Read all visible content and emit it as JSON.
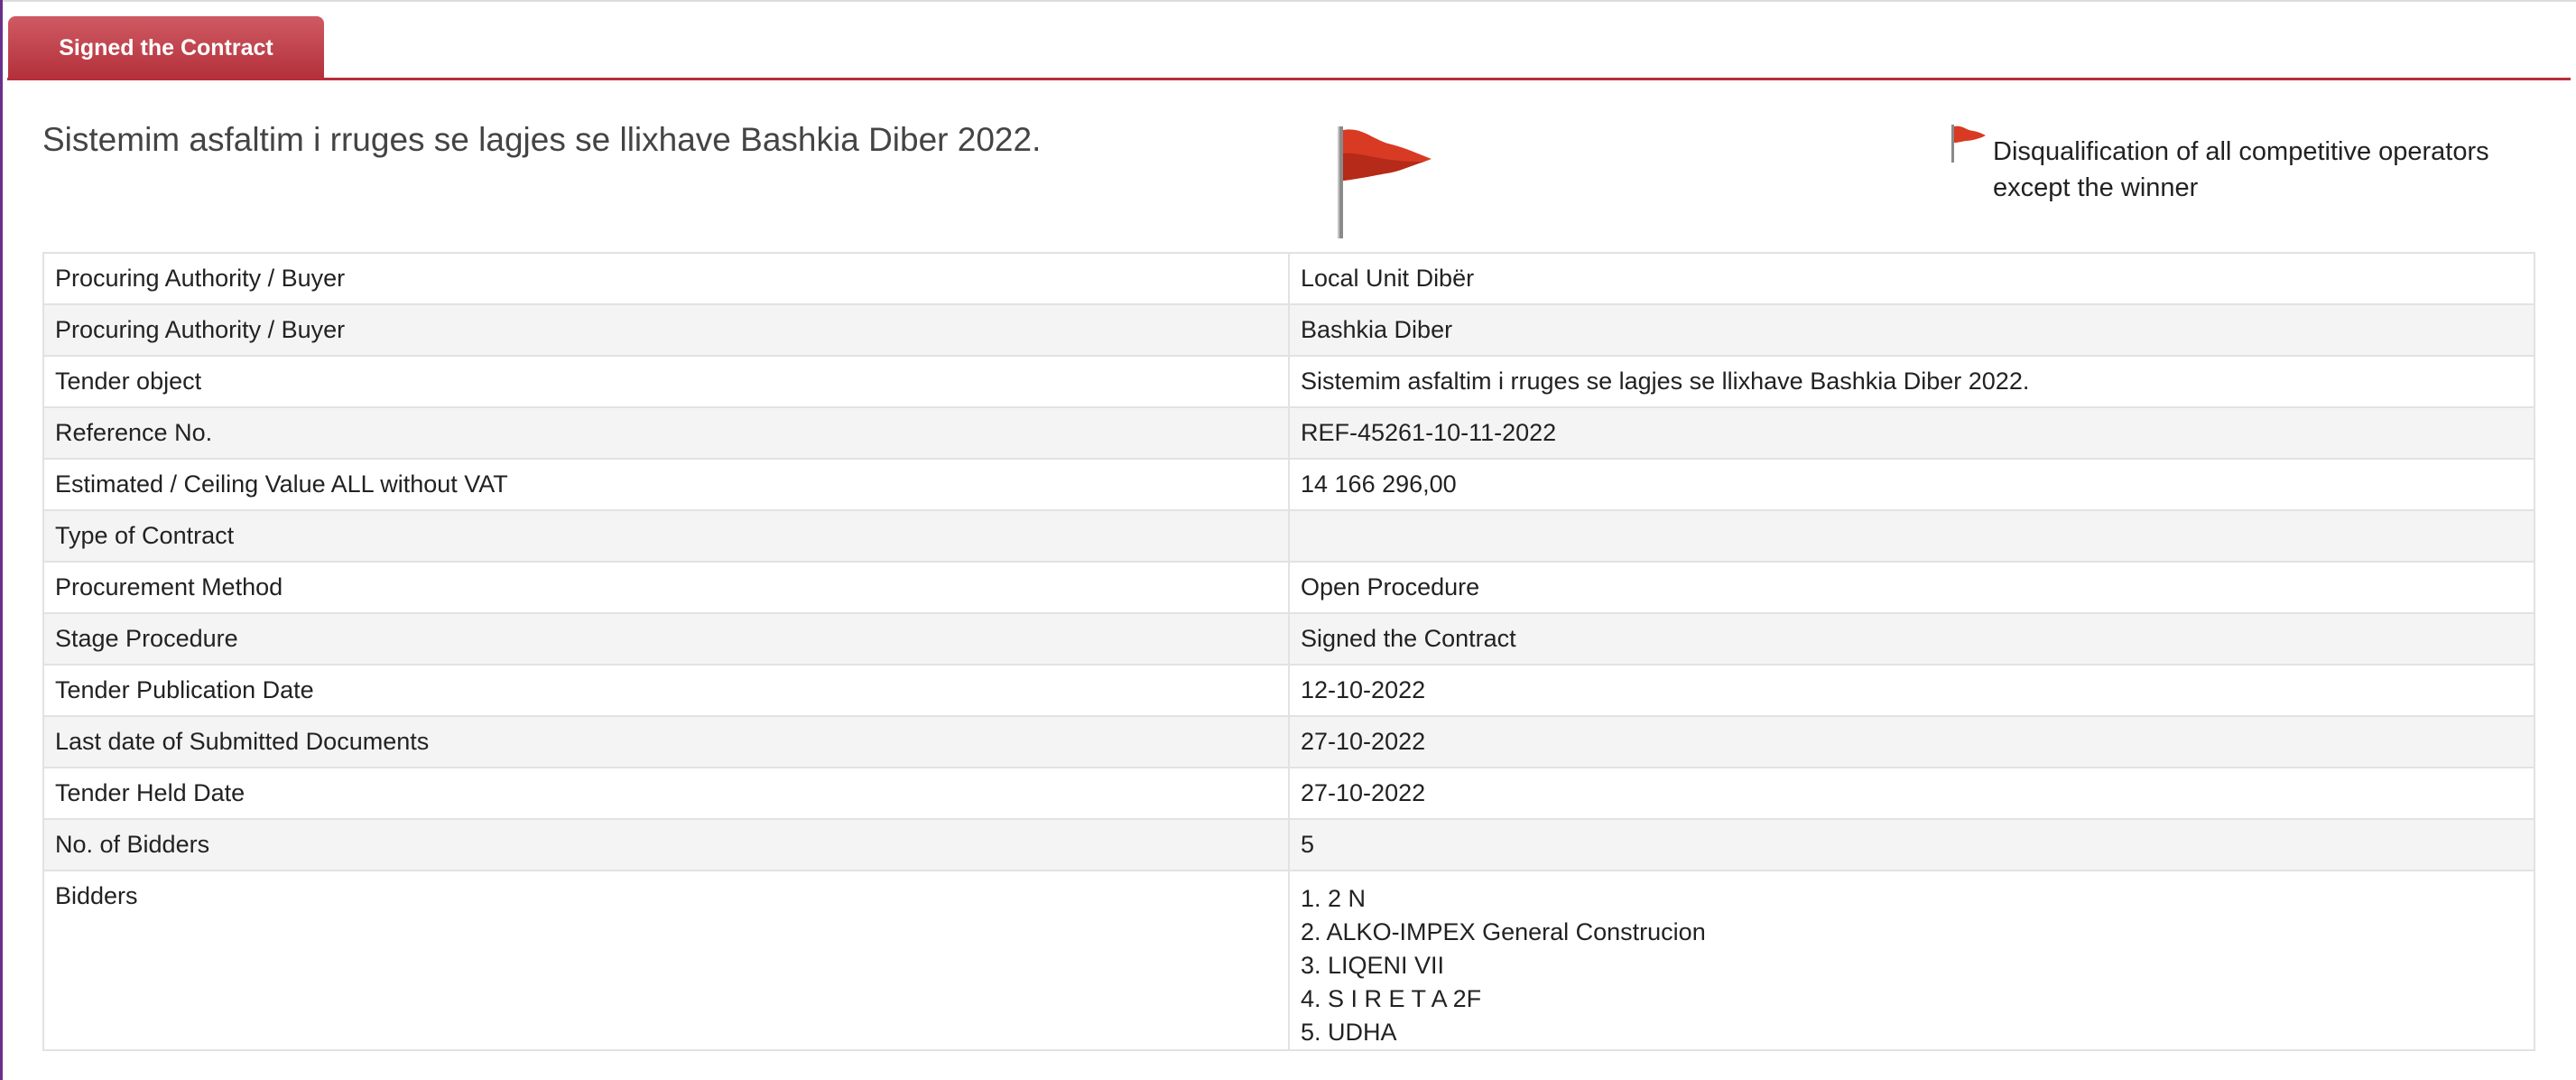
{
  "tab": {
    "label": "Signed the Contract"
  },
  "page_title": "Sistemim asfaltim i rruges se lagjes se llixhave Bashkia Diber 2022.",
  "flag_note": "Disqualification of all competitive operators except the winner",
  "colors": {
    "accent": "#b82e3a",
    "flag": "#d93a23",
    "row_alt": "#f4f4f4",
    "border": "#e2e2e2"
  },
  "icons": {
    "big_flag": "red-flag-icon",
    "small_flag": "red-flag-icon"
  },
  "details": [
    {
      "label": "Procuring Authority / Buyer",
      "value": "Local Unit Dibër"
    },
    {
      "label": "Procuring Authority / Buyer",
      "value": "Bashkia Diber"
    },
    {
      "label": "Tender object",
      "value": "Sistemim asfaltim i rruges se lagjes se llixhave Bashkia Diber 2022."
    },
    {
      "label": "Reference No.",
      "value": "REF-45261-10-11-2022"
    },
    {
      "label": "Estimated / Ceiling Value ALL without VAT",
      "value": "14 166 296,00"
    },
    {
      "label": "Type of Contract",
      "value": ""
    },
    {
      "label": "Procurement Method",
      "value": "Open Procedure"
    },
    {
      "label": "Stage Procedure",
      "value": "Signed the Contract"
    },
    {
      "label": "Tender Publication Date",
      "value": "12-10-2022"
    },
    {
      "label": "Last date of Submitted Documents",
      "value": "27-10-2022"
    },
    {
      "label": "Tender Held Date",
      "value": "27-10-2022"
    },
    {
      "label": "No. of Bidders",
      "value": "5"
    }
  ],
  "bidders": {
    "label": "Bidders",
    "items": [
      "1. 2 N",
      "2. ALKO-IMPEX General Construcion",
      "3. LIQENI VII",
      "4. S I R E T A 2F",
      "5. UDHA"
    ]
  }
}
